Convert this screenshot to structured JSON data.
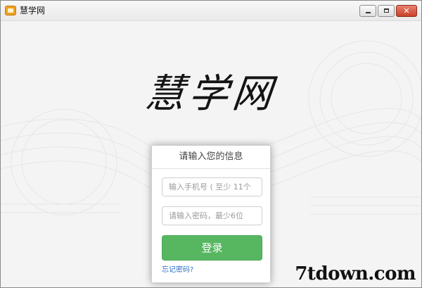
{
  "window": {
    "title": "慧学网",
    "minimize_icon": "minimize-icon",
    "maximize_icon": "maximize-icon",
    "close_label": "✕"
  },
  "main": {
    "logo_text": "慧学网"
  },
  "login": {
    "header": "请输入您的信息",
    "phone_placeholder": "输入手机号 ( 至少 11个",
    "password_placeholder": "请输入密码，最少6位",
    "login_button": "登录",
    "forgot_password": "忘记密码?"
  },
  "watermark": "7tdown.com",
  "colors": {
    "accent_green": "#57b761",
    "link_blue": "#2f6fc4",
    "close_red": "#c9412a"
  }
}
